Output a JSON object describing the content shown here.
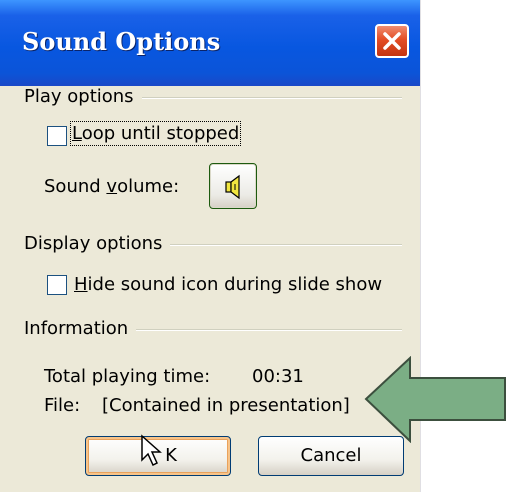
{
  "dialog": {
    "title": "Sound Options",
    "close_icon": "close-icon"
  },
  "play_options": {
    "group_label": "Play options",
    "loop": {
      "label_underlined": "L",
      "label_rest": "oop until stopped",
      "checked": false
    },
    "volume": {
      "label_pre": "Sound ",
      "label_underlined": "v",
      "label_post": "olume:",
      "icon": "speaker-icon"
    }
  },
  "display_options": {
    "group_label": "Display options",
    "hide_icon": {
      "label_underlined": "H",
      "label_rest": "ide sound icon during slide show",
      "checked": false
    }
  },
  "information": {
    "group_label": "Information",
    "total_time_label": "Total playing time:",
    "total_time_value": "00:31",
    "file_label": "File:",
    "file_value": "[Contained in presentation]"
  },
  "buttons": {
    "ok_label": "K",
    "cancel_label": "Cancel"
  },
  "annotation": {
    "arrow_color": "#7bae85",
    "arrow_direction": "left"
  },
  "colors": {
    "titlebar": "#0857e0",
    "dialog_bg": "#ece9d8",
    "close_button": "#e44d24"
  }
}
